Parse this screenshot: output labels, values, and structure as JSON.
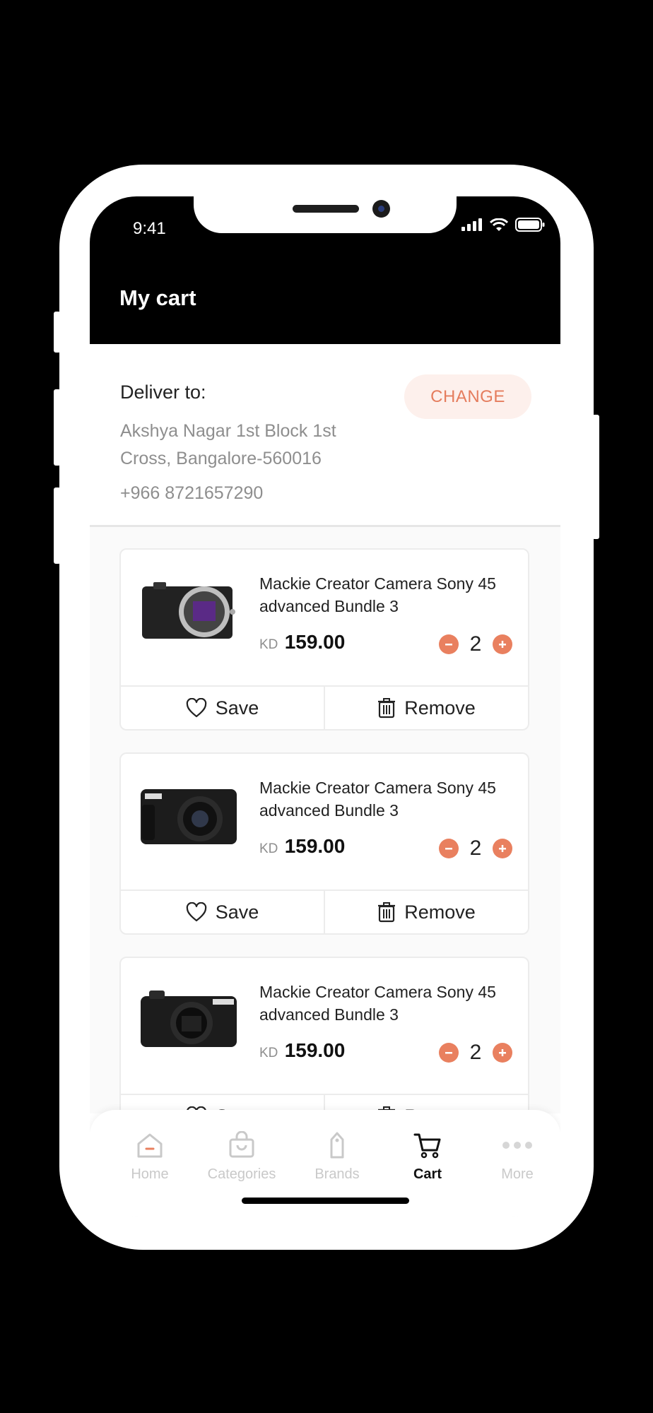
{
  "status": {
    "time": "9:41"
  },
  "header": {
    "title": "My cart"
  },
  "delivery": {
    "label": "Deliver to:",
    "address": "Akshya Nagar 1st Block 1st Cross, Bangalore-560016",
    "phone": "+966 8721657290",
    "change_label": "CHANGE"
  },
  "cart": {
    "items": [
      {
        "name": "Mackie Creator Camera Sony 45 advanced Bundle 3",
        "currency": "KD",
        "price": "159.00",
        "qty": "2",
        "save_label": "Save",
        "remove_label": "Remove"
      },
      {
        "name": "Mackie Creator Camera Sony 45 advanced Bundle 3",
        "currency": "KD",
        "price": "159.00",
        "qty": "2",
        "save_label": "Save",
        "remove_label": "Remove"
      },
      {
        "name": "Mackie Creator Camera Sony 45 advanced Bundle 3",
        "currency": "KD",
        "price": "159.00",
        "qty": "2",
        "save_label": "Save",
        "remove_label": "Remove"
      }
    ]
  },
  "tabs": [
    {
      "label": "Home",
      "icon": "home-icon"
    },
    {
      "label": "Categories",
      "icon": "shopping-bag-icon"
    },
    {
      "label": "Brands",
      "icon": "tag-icon"
    },
    {
      "label": "Cart",
      "icon": "cart-icon",
      "active": true
    },
    {
      "label": "More",
      "icon": "more-dots-icon"
    }
  ],
  "colors": {
    "accent": "#E9805F",
    "accent_bg": "#FDF0EC",
    "header_bg": "#000000"
  }
}
